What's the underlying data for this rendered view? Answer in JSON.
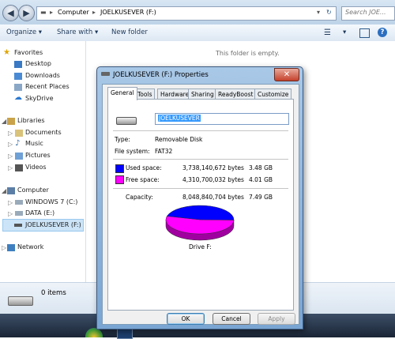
{
  "explorer": {
    "address": {
      "computer": "Computer",
      "drive": "JOELKUSEVER (F:)"
    },
    "search_placeholder": "Search JOE...",
    "toolbar": {
      "organize": "Organize",
      "share_with": "Share with",
      "new_folder": "New folder"
    },
    "empty_message": "This folder is empty.",
    "nav": {
      "favorites": "Favorites",
      "favorites_items": [
        "Desktop",
        "Downloads",
        "Recent Places",
        "SkyDrive"
      ],
      "libraries": "Libraries",
      "libraries_items": [
        "Documents",
        "Music",
        "Pictures",
        "Videos"
      ],
      "computer": "Computer",
      "computer_items": [
        "WINDOWS 7 (C:)",
        "DATA (E:)",
        "JOELKUSEVER (F:)"
      ],
      "network": "Network"
    },
    "status": {
      "items": "0 items"
    }
  },
  "dialog": {
    "title": "JOELKUSEVER (F:) Properties",
    "tabs": [
      "General",
      "Tools",
      "Hardware",
      "Sharing",
      "ReadyBoost",
      "Customize"
    ],
    "name_value": "JOELKUSEVER",
    "type_label": "Type:",
    "type_value": "Removable Disk",
    "fs_label": "File system:",
    "fs_value": "FAT32",
    "used": {
      "label": "Used space:",
      "bytes": "3,738,140,672 bytes",
      "gb": "3.48 GB",
      "color": "#0000ff"
    },
    "free": {
      "label": "Free space:",
      "bytes": "4,310,700,032 bytes",
      "gb": "4.01 GB",
      "color": "#ff00ff"
    },
    "capacity": {
      "label": "Capacity:",
      "bytes": "8,048,840,704 bytes",
      "gb": "7.49 GB"
    },
    "drive_label": "Drive F:",
    "used_fraction": 0.464,
    "buttons": {
      "ok": "OK",
      "cancel": "Cancel",
      "apply": "Apply"
    }
  }
}
